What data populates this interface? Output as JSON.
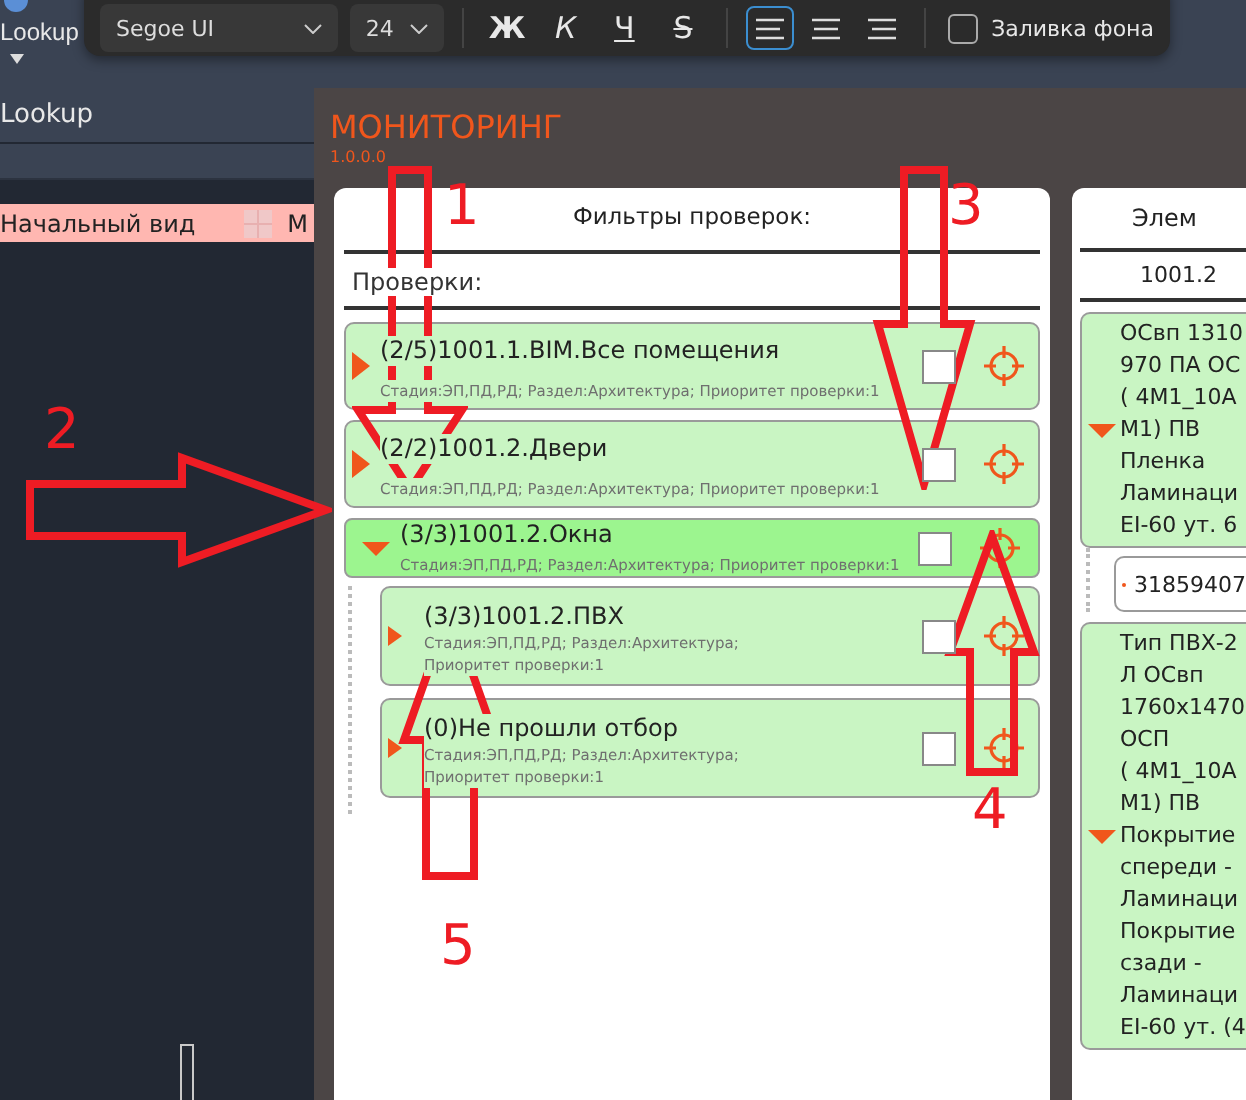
{
  "toolbar": {
    "font": "Segoe UI",
    "size": "24",
    "styles": [
      {
        "label": "Ж",
        "kind": "bold"
      },
      {
        "label": "К",
        "kind": "italic"
      },
      {
        "label": "Ч",
        "kind": "underline"
      },
      {
        "label": "S",
        "kind": "strike"
      }
    ],
    "align": [
      {
        "kind": "left",
        "selected": true
      },
      {
        "kind": "center",
        "selected": false
      },
      {
        "kind": "right",
        "selected": false
      }
    ],
    "fill": {
      "label": "Заливка фона",
      "checked": false
    }
  },
  "sidebar": {
    "title": "Lookup",
    "item": "Lookup",
    "view": {
      "label": "Начальный вид",
      "extra": "М"
    }
  },
  "window": {
    "title": "МОНИТОРИНГ",
    "version": "1.0.0.0"
  },
  "filters": {
    "title": "Фильтры проверок:",
    "subtitle": "Проверки:",
    "items": [
      {
        "title": "(2/5)1001.1.BIM.Все помещения",
        "subtitle": "Стадия:ЭП,ПД,РД; Раздел:Архитектура; Приоритет проверки:1",
        "expanded": false,
        "selected": false,
        "checked": false
      },
      {
        "title": "(2/2)1001.2.Двери",
        "subtitle": "Стадия:ЭП,ПД,РД; Раздел:Архитектура; Приоритет проверки:1",
        "expanded": false,
        "selected": false,
        "checked": false
      },
      {
        "title": "(3/3)1001.2.Окна",
        "subtitle": "Стадия:ЭП,ПД,РД; Раздел:Архитектура; Приоритет проверки:1",
        "expanded": true,
        "selected": true,
        "checked": false,
        "children": [
          {
            "title": "(3/3)1001.2.ПВХ",
            "subtitle": "Стадия:ЭП,ПД,РД; Раздел:Архитектура; Приоритет проверки:1",
            "expanded": false,
            "selected": false,
            "checked": false
          },
          {
            "title": "(0)Не прошли отбор",
            "subtitle": "Стадия:ЭП,ПД,РД; Раздел:Архитектура; Приоритет проверки:1",
            "expanded": false,
            "selected": false,
            "checked": false
          }
        ]
      }
    ]
  },
  "elements": {
    "title": "Элем",
    "subtitle": "1001.2",
    "items": [
      {
        "lines": [
          "ОСвп 1310",
          "970 ПА ОС",
          "( 4М1_10А",
          "М1) ПВ",
          "Пленка",
          "Ламинаци",
          "EI-60 ут. 6"
        ],
        "expanded": true,
        "children": [
          {
            "label": "31859407"
          }
        ]
      },
      {
        "lines": [
          "Тип ПВХ-2",
          "Л ОСвп",
          "1760х1470",
          "ОСП",
          "( 4М1_10А",
          "М1) ПВ",
          "Покрытие",
          "спереди -",
          "Ламинаци",
          "Покрытие",
          "сзади -",
          "Ламинаци",
          "EI-60 ут. (4"
        ],
        "expanded": true
      }
    ]
  },
  "annotations": [
    {
      "label": "1",
      "kind": "down-arrow"
    },
    {
      "label": "2",
      "kind": "right-arrow"
    },
    {
      "label": "3",
      "kind": "down-arrow"
    },
    {
      "label": "4",
      "kind": "up-arrow"
    },
    {
      "label": "5",
      "kind": "up-arrow"
    }
  ]
}
